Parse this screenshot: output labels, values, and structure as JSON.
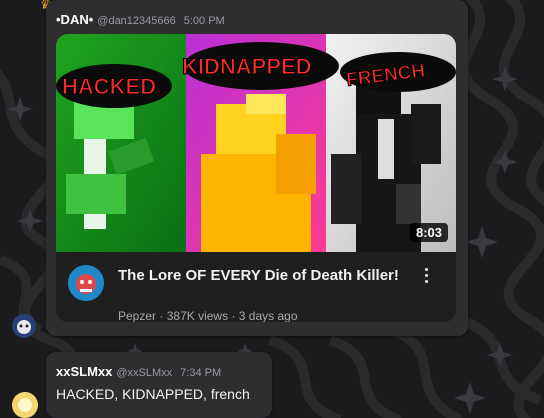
{
  "messages": [
    {
      "author": "•DAN•",
      "handle": "@dan12345666",
      "time": "5:00 PM",
      "embed": {
        "thumb_words": [
          "HACKED",
          "KIDNAPPED",
          "FRENCH"
        ],
        "duration": "8:03",
        "title": "The Lore OF EVERY Die of Death Killer!",
        "channel": "Pepzer",
        "views": "387K views",
        "age": "3 days ago",
        "meta_separator": "·"
      }
    },
    {
      "author": "xxSLMxx",
      "handle": "@xxSLMxx",
      "time": "7:34 PM",
      "text": "HACKED, KIDNAPPED, french"
    }
  ],
  "colors": {
    "bubble": "#2e2e31",
    "background": "#1b1b1d",
    "red_text": "#ff2a2a",
    "thumb_green": "#25c42a",
    "thumb_pink": "#d21f9b"
  },
  "icons": [
    "crown-icon",
    "more-options-icon",
    "channel-avatar",
    "sparkle-icon"
  ]
}
